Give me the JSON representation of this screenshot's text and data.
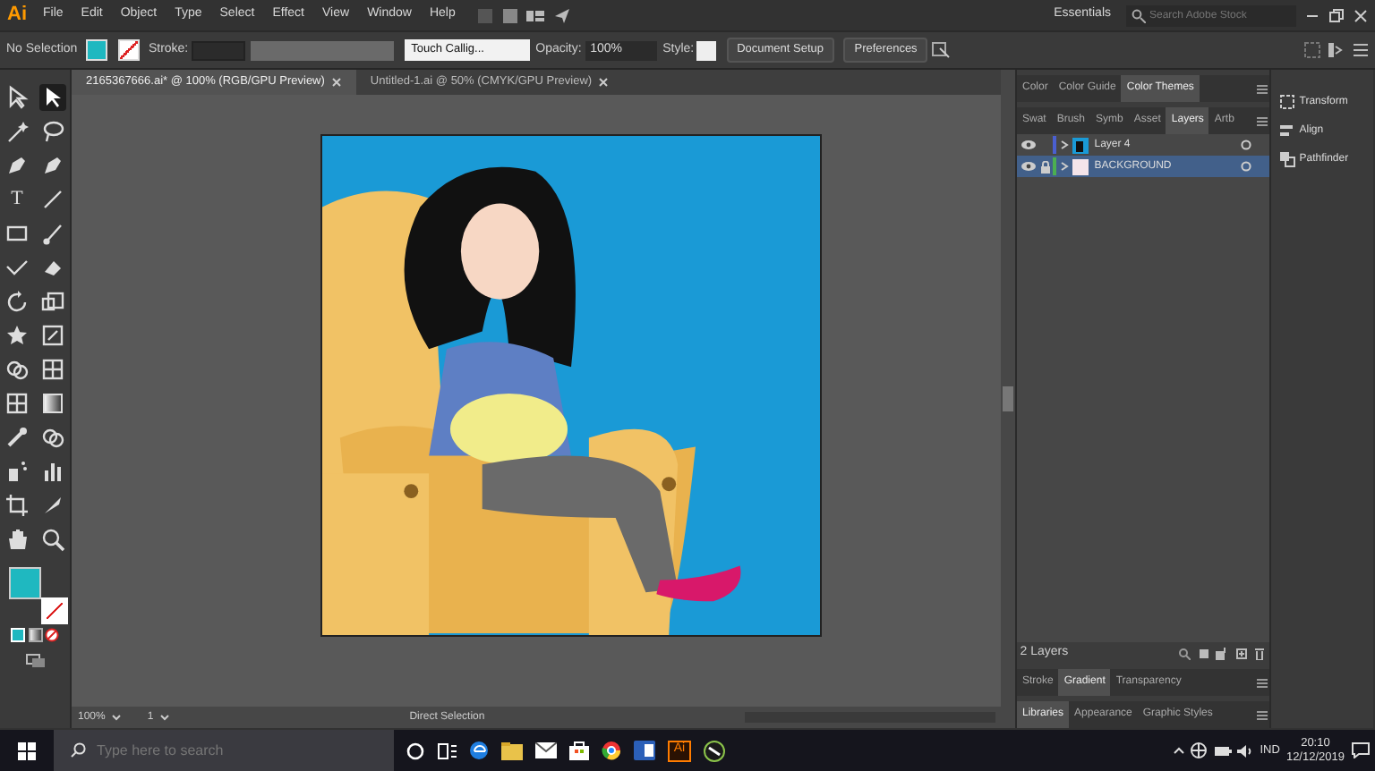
{
  "menu_bar": {
    "logo": "Ai",
    "items": [
      "File",
      "Edit",
      "Object",
      "Type",
      "Select",
      "Effect",
      "View",
      "Window",
      "Help"
    ],
    "workspace": "Essentials",
    "search": {
      "placeholder": "Search Adobe Stock"
    }
  },
  "control_bar": {
    "selection": "No Selection",
    "stroke_label": "Stroke:",
    "brush": "Touch Callig...",
    "opacity_label": "Opacity:",
    "opacity": "100%",
    "style_label": "Style:",
    "buttons": [
      "Document Setup",
      "Preferences"
    ]
  },
  "document_tabs": [
    {
      "label": "2165367666.ai* @ 100% (RGB/GPU Preview)",
      "selected": true
    },
    {
      "label": "Untitled-1.ai @ 50% (CMYK/GPU Preview)",
      "selected": false
    }
  ],
  "tools": [
    {
      "kind": "hollow-arrow",
      "selected": false
    },
    {
      "kind": "arrow",
      "selected": true
    },
    {
      "kind": "wand",
      "selected": false
    },
    {
      "kind": "lasso",
      "selected": false
    },
    {
      "kind": "pen",
      "selected": false
    },
    {
      "kind": "pen",
      "selected": false
    },
    {
      "kind": "type",
      "label": "T",
      "selected": false
    },
    {
      "kind": "line",
      "selected": false
    },
    {
      "kind": "rectangle",
      "selected": false
    },
    {
      "kind": "brush",
      "selected": false
    },
    {
      "kind": "check",
      "selected": false
    },
    {
      "kind": "eraser",
      "selected": false
    },
    {
      "kind": "rotate",
      "selected": false
    },
    {
      "kind": "scale",
      "selected": false
    },
    {
      "kind": "star",
      "selected": false
    },
    {
      "kind": "frame",
      "selected": false
    },
    {
      "kind": "circles",
      "selected": false
    },
    {
      "kind": "grid",
      "selected": false
    },
    {
      "kind": "grid",
      "selected": false
    },
    {
      "kind": "gradient",
      "selected": false
    },
    {
      "kind": "eyedropper",
      "selected": false
    },
    {
      "kind": "circles",
      "selected": false
    },
    {
      "kind": "spray",
      "selected": false
    },
    {
      "kind": "chart",
      "selected": false
    },
    {
      "kind": "crop",
      "selected": false
    },
    {
      "kind": "knife",
      "selected": false
    },
    {
      "kind": "hand",
      "selected": false
    },
    {
      "kind": "zoom",
      "selected": false
    }
  ],
  "status_bar": {
    "zoom": "100%",
    "artboard": "1",
    "tool": "Direct Selection"
  },
  "panels": {
    "color_tabs": [
      {
        "label": "Color",
        "selected": false
      },
      {
        "label": "Color Guide",
        "selected": false
      },
      {
        "label": "Color Themes",
        "selected": true
      }
    ],
    "layer_tabs": [
      {
        "label": "Swat",
        "selected": false
      },
      {
        "label": "Brush",
        "selected": false
      },
      {
        "label": "Symb",
        "selected": false
      },
      {
        "label": "Asset",
        "selected": false
      },
      {
        "label": "Layers",
        "selected": true
      },
      {
        "label": "Artb",
        "selected": false
      }
    ],
    "layers": [
      {
        "name": "Layer 4",
        "selected": false,
        "locked": false,
        "color": "#4a5fd0"
      },
      {
        "name": "BACKGROUND",
        "selected": true,
        "locked": true,
        "color": "#4caf50"
      }
    ],
    "layer_count": "2 Layers",
    "bottom_tabs": [
      {
        "label": "Stroke",
        "selected": false
      },
      {
        "label": "Gradient",
        "selected": true
      },
      {
        "label": "Transparency",
        "selected": false
      }
    ],
    "library_tabs": [
      {
        "label": "Libraries",
        "selected": true
      },
      {
        "label": "Appearance",
        "selected": false
      },
      {
        "label": "Graphic Styles",
        "selected": false
      }
    ]
  },
  "side_panel": [
    "Transform",
    "Align",
    "Pathfinder"
  ],
  "taskbar": {
    "search": {
      "placeholder": "Type here to search"
    },
    "app_label": "Ai",
    "language": "IND",
    "time": "20:10",
    "date": "12/12/2019"
  }
}
